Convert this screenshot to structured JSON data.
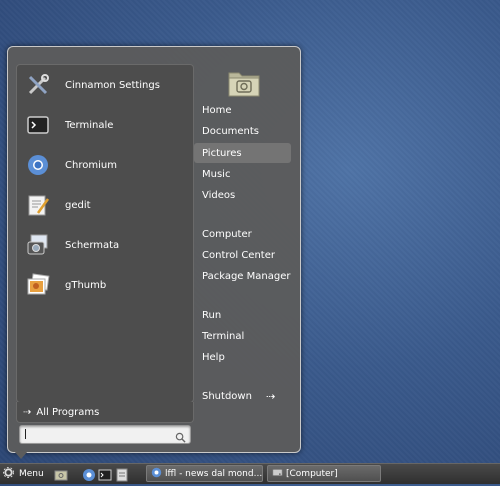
{
  "favorites": [
    {
      "label": "Cinnamon Settings",
      "icon": "settings-tools-icon"
    },
    {
      "label": "Terminale",
      "icon": "terminal-icon"
    },
    {
      "label": "Chromium",
      "icon": "chromium-icon"
    },
    {
      "label": "gedit",
      "icon": "text-editor-icon"
    },
    {
      "label": "Schermata",
      "icon": "screenshot-icon"
    },
    {
      "label": "gThumb",
      "icon": "image-viewer-icon"
    }
  ],
  "all_programs_label": "All Programs",
  "search": {
    "value": ""
  },
  "places_icon": "pictures-folder-icon",
  "places": [
    {
      "label": "Home"
    },
    {
      "label": "Documents"
    },
    {
      "label": "Pictures",
      "selected": true
    },
    {
      "label": "Music"
    },
    {
      "label": "Videos"
    }
  ],
  "system": [
    {
      "label": "Computer"
    },
    {
      "label": "Control Center"
    },
    {
      "label": "Package Manager"
    }
  ],
  "actions": [
    {
      "label": "Run"
    },
    {
      "label": "Terminal"
    },
    {
      "label": "Help"
    }
  ],
  "shutdown_label": "Shutdown",
  "taskbar": {
    "menu_label": "Menu",
    "launchers": [
      "folder-camera-icon",
      "chromium-icon",
      "terminal-icon",
      "document-viewer-icon"
    ],
    "windows": [
      {
        "label": "lffl - news dal mond...",
        "icon": "chromium-icon"
      },
      {
        "label": "[Computer]",
        "icon": "drive-icon"
      }
    ]
  },
  "colors": {
    "menu_bg": "#5c5c5c",
    "selected": "#747474",
    "desktop": "#3a5a8c"
  }
}
